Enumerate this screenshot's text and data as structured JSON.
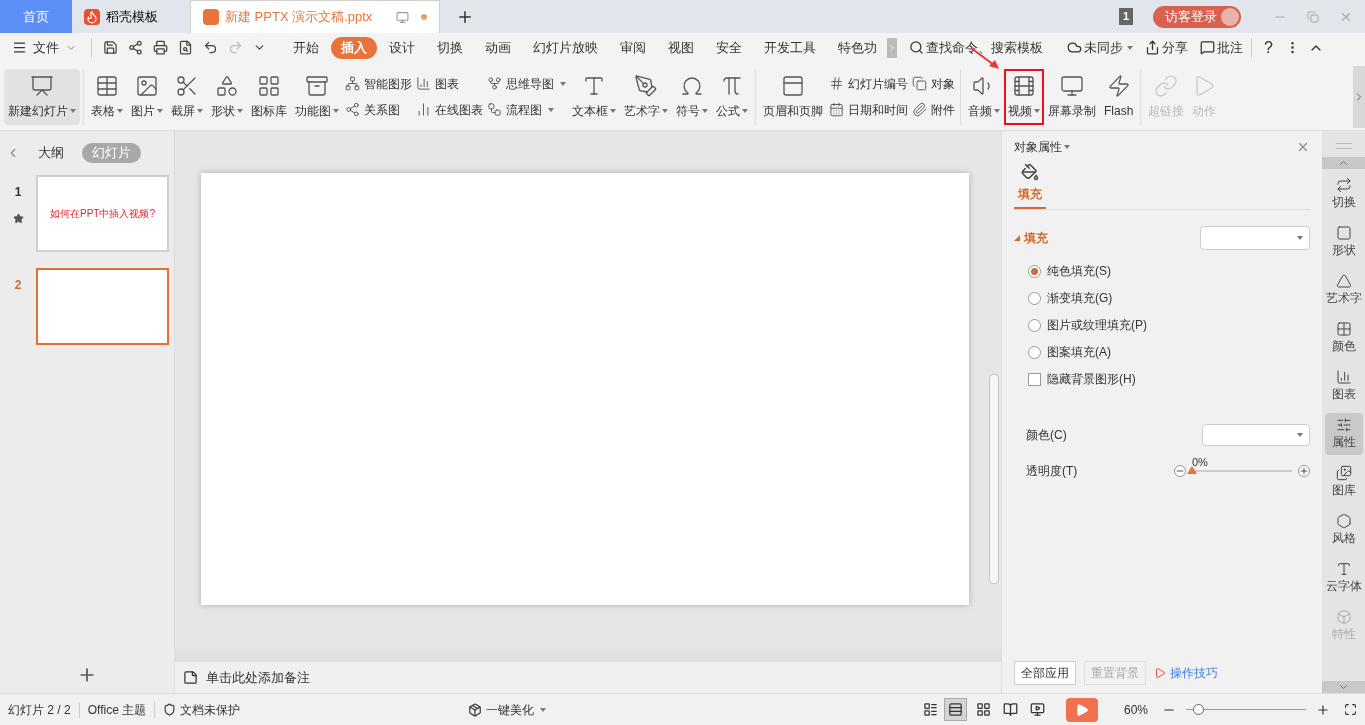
{
  "title_bar": {
    "tabs": [
      {
        "label": "首页",
        "kind": "home",
        "selected": false
      },
      {
        "label": "稻壳模板",
        "kind": "docer",
        "selected": false
      },
      {
        "label": "新建 PPTX 演示文稿.pptx",
        "kind": "document",
        "selected": true,
        "modified": true
      }
    ],
    "window_count": "1",
    "login": "访客登录"
  },
  "menu_bar": {
    "file": "文件",
    "tabs": [
      {
        "label": "开始",
        "selected": false
      },
      {
        "label": "插入",
        "selected": true
      },
      {
        "label": "设计",
        "selected": false
      },
      {
        "label": "切换",
        "selected": false
      },
      {
        "label": "动画",
        "selected": false
      },
      {
        "label": "幻灯片放映",
        "selected": false
      },
      {
        "label": "审阅",
        "selected": false
      },
      {
        "label": "视图",
        "selected": false
      },
      {
        "label": "安全",
        "selected": false
      },
      {
        "label": "开发工具",
        "selected": false
      },
      {
        "label": "特色功",
        "selected": false
      }
    ],
    "search": "查找命令、搜索模板",
    "actions": [
      {
        "label": "未同步",
        "dropdown": true
      },
      {
        "label": "分享",
        "dropdown": false
      },
      {
        "label": "批注",
        "dropdown": false
      }
    ],
    "help": "?"
  },
  "ribbon": {
    "groups": [
      [
        {
          "kind": "large",
          "label": "新建幻灯片",
          "dropdown": true,
          "disabled": false,
          "highlighted": false
        }
      ],
      [
        {
          "kind": "large",
          "label": "表格",
          "dropdown": true,
          "disabled": false,
          "highlighted": false
        },
        {
          "kind": "large",
          "label": "图片",
          "dropdown": true,
          "disabled": false,
          "highlighted": false
        },
        {
          "kind": "large",
          "label": "截屏",
          "dropdown": true,
          "disabled": false,
          "highlighted": false
        },
        {
          "kind": "large",
          "label": "形状",
          "dropdown": true,
          "disabled": false,
          "highlighted": false
        },
        {
          "kind": "large",
          "label": "图标库",
          "dropdown": false,
          "disabled": false,
          "highlighted": false
        },
        {
          "kind": "large",
          "label": "功能图",
          "dropdown": true,
          "disabled": false,
          "highlighted": false
        },
        {
          "kind": "stack",
          "items": [
            {
              "label": "智能图形",
              "dropdown": false
            },
            {
              "label": "关系图",
              "dropdown": false
            }
          ]
        },
        {
          "kind": "stack",
          "items": [
            {
              "label": "图表",
              "dropdown": false
            },
            {
              "label": "在线图表",
              "dropdown": false
            }
          ]
        },
        {
          "kind": "stack",
          "items": [
            {
              "label": "思维导图",
              "dropdown": true
            },
            {
              "label": "流程图",
              "dropdown": true
            }
          ]
        },
        {
          "kind": "large",
          "label": "文本框",
          "dropdown": true,
          "disabled": false,
          "highlighted": false
        },
        {
          "kind": "large",
          "label": "艺术字",
          "dropdown": true,
          "disabled": false,
          "highlighted": false
        },
        {
          "kind": "large",
          "label": "符号",
          "dropdown": true,
          "disabled": false,
          "highlighted": false
        },
        {
          "kind": "large",
          "label": "公式",
          "dropdown": true,
          "disabled": false,
          "highlighted": false
        }
      ],
      [
        {
          "kind": "large",
          "label": "页眉和页脚",
          "dropdown": false,
          "disabled": false,
          "highlighted": false
        },
        {
          "kind": "stack",
          "items": [
            {
              "label": "幻灯片编号",
              "dropdown": false
            },
            {
              "label": "日期和时间",
              "dropdown": false
            }
          ]
        },
        {
          "kind": "stack",
          "items": [
            {
              "label": "对象",
              "dropdown": false
            },
            {
              "label": "附件",
              "dropdown": false
            }
          ]
        }
      ],
      [
        {
          "kind": "large",
          "label": "音频",
          "dropdown": true,
          "disabled": false,
          "highlighted": false
        },
        {
          "kind": "large",
          "label": "视频",
          "dropdown": true,
          "disabled": false,
          "highlighted": true
        },
        {
          "kind": "large",
          "label": "屏幕录制",
          "dropdown": false,
          "disabled": false,
          "highlighted": false
        },
        {
          "kind": "large",
          "label": "Flash",
          "dropdown": false,
          "disabled": false,
          "highlighted": false
        }
      ],
      [
        {
          "kind": "large",
          "label": "超链接",
          "dropdown": false,
          "disabled": true,
          "highlighted": false
        },
        {
          "kind": "large",
          "label": "动作",
          "dropdown": false,
          "disabled": true,
          "highlighted": false
        }
      ]
    ]
  },
  "slide_panel": {
    "views": [
      {
        "label": "大纲",
        "selected": false
      },
      {
        "label": "幻灯片",
        "selected": true
      }
    ],
    "slides": [
      {
        "number": "1",
        "selected": false,
        "title": "如何在PPT中插入视频?",
        "animated": true
      },
      {
        "number": "2",
        "selected": true,
        "animated": false
      }
    ]
  },
  "notes": {
    "placeholder": "单击此处添加备注"
  },
  "properties_panel": {
    "title": "对象属性",
    "tabs": [
      {
        "label": "填充",
        "selected": true
      }
    ],
    "section": {
      "label": "填充",
      "expanded": true
    },
    "fill_options": [
      {
        "label": "纯色填充(S)",
        "selected": true
      },
      {
        "label": "渐变填充(G)",
        "selected": false
      },
      {
        "label": "图片或纹理填充(P)",
        "selected": false
      },
      {
        "label": "图案填充(A)",
        "selected": false
      }
    ],
    "hide_background": {
      "label": "隐藏背景图形(H)",
      "checked": false
    },
    "color_label": "颜色(C)",
    "transparency": {
      "label": "透明度(T)",
      "reading": "0%",
      "level": 0
    },
    "buttons": [
      {
        "label": "全部应用",
        "disabled": false
      },
      {
        "label": "重置背景",
        "disabled": true
      }
    ],
    "tips": "操作技巧"
  },
  "side_bar": [
    {
      "label": "切换",
      "selected": false,
      "disabled": false
    },
    {
      "label": "形状",
      "selected": false,
      "disabled": false
    },
    {
      "label": "艺术字",
      "selected": false,
      "disabled": false
    },
    {
      "label": "颜色",
      "selected": false,
      "disabled": false
    },
    {
      "label": "图表",
      "selected": false,
      "disabled": false
    },
    {
      "label": "属性",
      "selected": true,
      "disabled": false
    },
    {
      "label": "图库",
      "selected": false,
      "disabled": false
    },
    {
      "label": "风格",
      "selected": false,
      "disabled": false
    },
    {
      "label": "云字体",
      "selected": false,
      "disabled": false
    },
    {
      "label": "特性",
      "selected": false,
      "disabled": true
    }
  ],
  "status_bar": {
    "slide": "幻灯片 2 / 2",
    "theme": "Office 主题",
    "protection": "文档未保护",
    "beautify": "一键美化",
    "views": [
      {
        "selected": true
      },
      {
        "selected": false
      },
      {
        "selected": false
      },
      {
        "selected": false
      }
    ],
    "zoom": "60%",
    "zoom_level": {
      "level": 0.1
    }
  }
}
